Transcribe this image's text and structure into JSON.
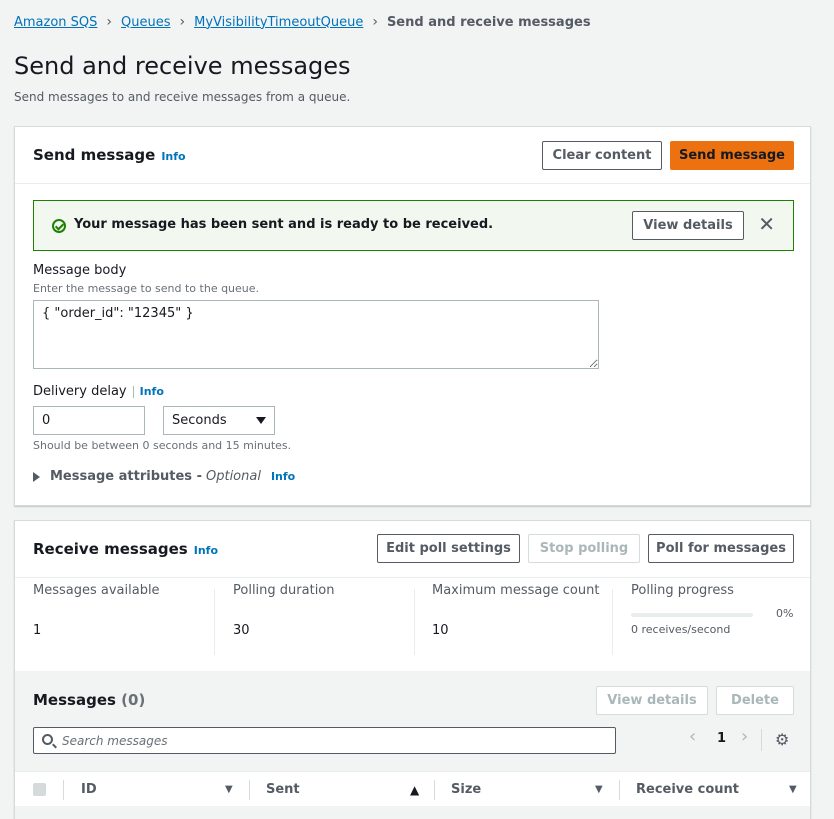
{
  "breadcrumb": {
    "items": [
      "Amazon SQS",
      "Queues",
      "MyVisibilityTimeoutQueue"
    ],
    "current": "Send and receive messages",
    "separator": "›"
  },
  "page": {
    "title": "Send and receive messages",
    "description": "Send messages to and receive messages from a queue."
  },
  "send": {
    "title": "Send message",
    "info": "Info",
    "clear_label": "Clear content",
    "send_label": "Send message",
    "alert": {
      "text": "Your message has been sent and is ready to be received.",
      "view_details": "View details",
      "close": "✕"
    },
    "body": {
      "label": "Message body",
      "description": "Enter the message to send to the queue.",
      "value": "{ \"order_id\": \"12345\" }"
    },
    "delay": {
      "label": "Delivery delay",
      "info": "Info",
      "value": "0",
      "unit": "Seconds",
      "hint": "Should be between 0 seconds and 15 minutes."
    },
    "attributes": {
      "label": "Message attributes - ",
      "optional": "Optional",
      "info": "Info"
    }
  },
  "receive": {
    "title": "Receive messages",
    "info": "Info",
    "edit_poll_label": "Edit poll settings",
    "stop_polling_label": "Stop polling",
    "poll_label": "Poll for messages",
    "stats": [
      {
        "label": "Messages available",
        "value": "1"
      },
      {
        "label": "Polling duration",
        "value": "30"
      },
      {
        "label": "Maximum message count",
        "value": "10"
      }
    ],
    "progress": {
      "label": "Polling progress",
      "percent_text": "0%",
      "fraction": 0,
      "sub": "0 receives/second"
    }
  },
  "messages": {
    "title": "Messages",
    "count": "(0)",
    "view_details_label": "View details",
    "delete_label": "Delete",
    "search_placeholder": "Search messages",
    "page": "1",
    "prev": "‹",
    "next": "›",
    "gear": "⚙",
    "columns": [
      "ID",
      "Sent",
      "Size",
      "Receive count"
    ],
    "sort_down": "▼",
    "sort_up": "▲"
  }
}
